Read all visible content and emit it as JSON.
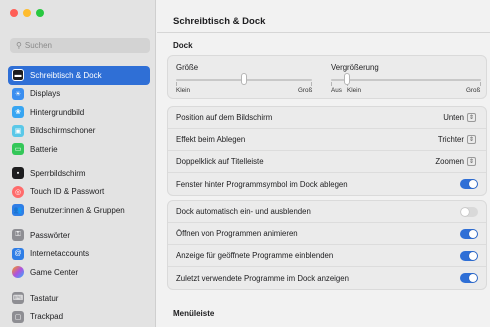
{
  "window": {
    "title": "Schreibtisch & Dock"
  },
  "sidebar": {
    "search_placeholder": "Suchen",
    "items": [
      {
        "label": "Schreibtisch & Dock",
        "icon": "desktop-dock-icon",
        "color": "#1d1d1f",
        "active": true
      },
      {
        "label": "Displays",
        "icon": "displays-icon",
        "color": "#3a8ef0"
      },
      {
        "label": "Hintergrundbild",
        "icon": "wallpaper-icon",
        "color": "#37a5f2"
      },
      {
        "label": "Bildschirmschoner",
        "icon": "screensaver-icon",
        "color": "#5ac8e8"
      },
      {
        "label": "Batterie",
        "icon": "battery-icon",
        "color": "#34c759"
      },
      {
        "label": "Sperrbildschirm",
        "icon": "lock-screen-icon",
        "color": "#1d1d1f"
      },
      {
        "label": "Touch ID & Passwort",
        "icon": "fingerprint-icon",
        "color": "#ff6b6b"
      },
      {
        "label": "Benutzer:innen & Gruppen",
        "icon": "users-icon",
        "color": "#2f7ee6"
      },
      {
        "label": "Passwörter",
        "icon": "key-icon",
        "color": "#8e8e93"
      },
      {
        "label": "Internetaccounts",
        "icon": "at-icon",
        "color": "#2f7ee6"
      },
      {
        "label": "Game Center",
        "icon": "game-center-icon",
        "color": "#ff9f0a"
      },
      {
        "label": "Tastatur",
        "icon": "keyboard-icon",
        "color": "#8e8e93"
      },
      {
        "label": "Trackpad",
        "icon": "trackpad-icon",
        "color": "#8e8e93"
      }
    ]
  },
  "dock_section": {
    "title": "Dock",
    "size": {
      "label": "Größe",
      "min": "Klein",
      "max": "Groß",
      "value": 0.5
    },
    "magnification": {
      "label": "Vergrößerung",
      "off": "Aus",
      "min": "Klein",
      "max": "Groß",
      "value": 0.0
    }
  },
  "settings_group1": [
    {
      "label": "Position auf dem Bildschirm",
      "value": "Unten"
    },
    {
      "label": "Effekt beim Ablegen",
      "value": "Trichter"
    },
    {
      "label": "Doppelklick auf Titelleiste",
      "value": "Zoomen"
    },
    {
      "label": "Fenster hinter Programmsymbol im Dock ablegen",
      "toggle": true
    }
  ],
  "settings_group2": [
    {
      "label": "Dock automatisch ein- und ausblenden",
      "toggle": false
    },
    {
      "label": "Öffnen von Programmen animieren",
      "toggle": true
    },
    {
      "label": "Anzeige für geöffnete Programme einblenden",
      "toggle": true
    },
    {
      "label": "Zuletzt verwendete Programme im Dock anzeigen",
      "toggle": true
    }
  ],
  "menubar_section": {
    "title": "Menüleiste"
  },
  "colors": {
    "accent": "#2f6fd6"
  }
}
